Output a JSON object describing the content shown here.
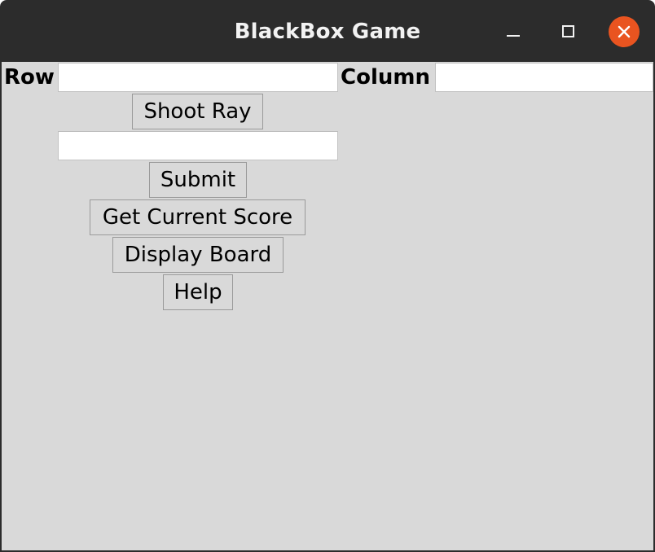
{
  "window": {
    "title": "BlackBox Game",
    "controls": {
      "minimize": "minimize-icon",
      "maximize": "maximize-icon",
      "close": "close-icon",
      "close_color": "#e95420"
    }
  },
  "form": {
    "row_label": "Row",
    "row_value": "",
    "column_label": "Column",
    "column_value": "",
    "shoot_ray_label": "Shoot Ray",
    "guess_value": "",
    "submit_label": "Submit",
    "get_score_label": "Get Current Score",
    "display_board_label": "Display Board",
    "help_label": "Help"
  },
  "colors": {
    "background": "#d9d9d9",
    "titlebar": "#2c2c2c",
    "entry": "#ffffff"
  }
}
